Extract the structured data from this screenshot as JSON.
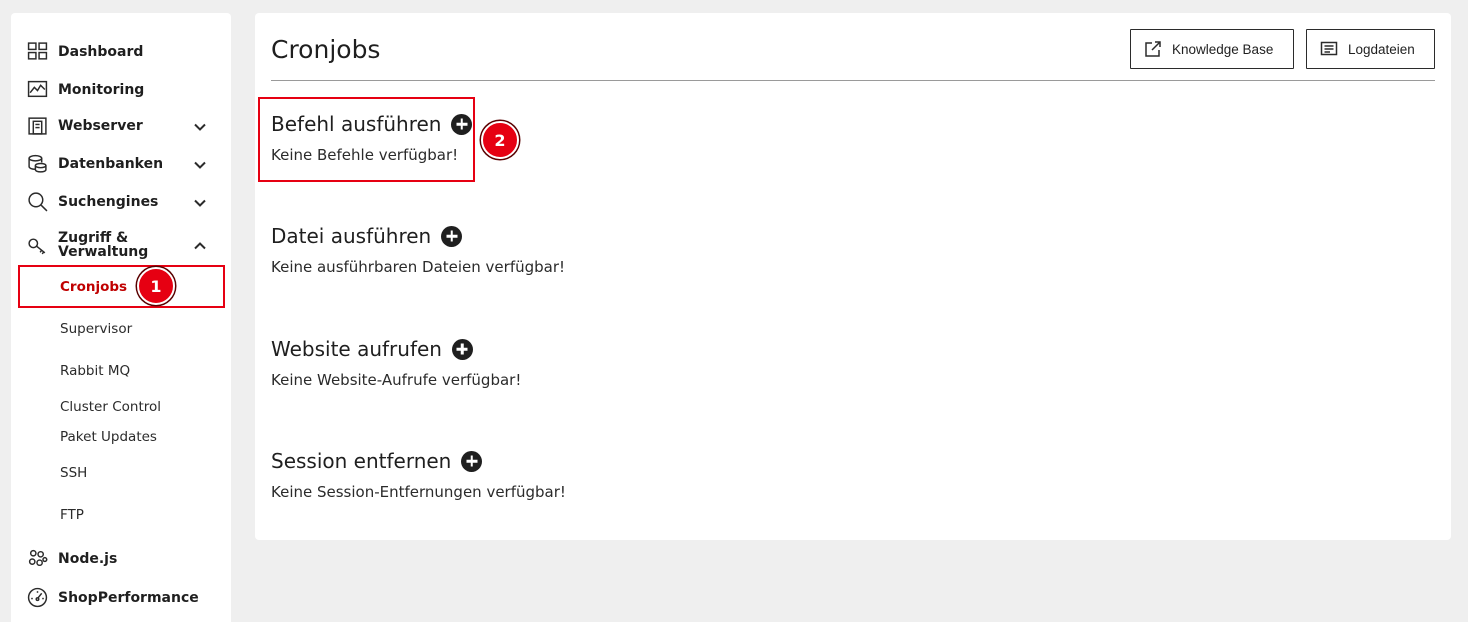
{
  "sidebar": {
    "items": [
      {
        "label": "Dashboard",
        "icon": "dashboard-icon"
      },
      {
        "label": "Monitoring",
        "icon": "monitoring-icon"
      },
      {
        "label": "Webserver",
        "icon": "webserver-icon"
      },
      {
        "label": "Datenbanken",
        "icon": "database-icon"
      },
      {
        "label": "Suchengines",
        "icon": "search-icon"
      },
      {
        "label": "Zugriff &\nVerwaltung",
        "icon": "key-icon"
      },
      {
        "label": "Node.js",
        "icon": "nodejs-icon"
      },
      {
        "label": "ShopPerformance",
        "icon": "gauge-icon"
      }
    ],
    "subitems": [
      "Cronjobs",
      "Supervisor",
      "Rabbit MQ",
      "Cluster Control",
      "Paket Updates",
      "SSH",
      "FTP"
    ],
    "active_subitem": "Cronjobs"
  },
  "annotations": {
    "badge1": "1",
    "badge2": "2",
    "color": "#e60012"
  },
  "main": {
    "title": "Cronjobs",
    "buttons": {
      "knowledge_base": "Knowledge Base",
      "logs": "Logdateien"
    },
    "sections": [
      {
        "title": "Befehl ausführen",
        "empty": "Keine Befehle verfügbar!"
      },
      {
        "title": "Datei ausführen",
        "empty": "Keine ausführbaren Dateien verfügbar!"
      },
      {
        "title": "Website aufrufen",
        "empty": "Keine Website-Aufrufe verfügbar!"
      },
      {
        "title": "Session entfernen",
        "empty": "Keine Session-Entfernungen verfügbar!"
      }
    ]
  }
}
